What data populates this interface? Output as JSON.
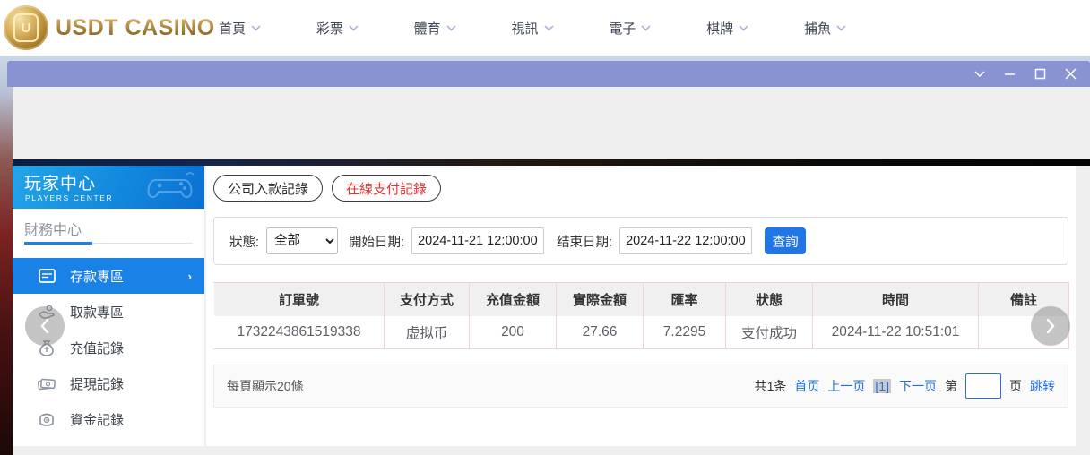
{
  "brand": {
    "name": "USDT CASINO",
    "emblem_letter": "U",
    "gold_color": "#a8823d"
  },
  "nav": {
    "items": [
      {
        "label": "首頁"
      },
      {
        "label": "彩票"
      },
      {
        "label": "體育"
      },
      {
        "label": "視訊"
      },
      {
        "label": "電子"
      },
      {
        "label": "棋牌"
      },
      {
        "label": "捕魚"
      }
    ]
  },
  "window": {
    "titlebar_color": "#8a93d2",
    "controls": [
      "collapse-icon",
      "minimize-icon",
      "maximize-icon",
      "close-icon"
    ]
  },
  "sidebar": {
    "title": "玩家中心",
    "subtitle": "PLAYERS CENTER",
    "section_title": "財務中心",
    "active_color": "#1a82e6",
    "items": [
      {
        "label": "存款專區",
        "icon": "deposit-card-icon",
        "active": true
      },
      {
        "label": "取款專區",
        "icon": "withdraw-hand-icon",
        "active": false
      },
      {
        "label": "充值記錄",
        "icon": "recharge-bag-icon",
        "active": false
      },
      {
        "label": "提現記錄",
        "icon": "cash-notes-icon",
        "active": false
      },
      {
        "label": "資金記錄",
        "icon": "funds-wallet-icon",
        "active": false
      }
    ]
  },
  "main": {
    "tabs": [
      {
        "label": "公司入款記錄",
        "active": false
      },
      {
        "label": "在線支付記錄",
        "active": true,
        "active_color": "#e53535"
      }
    ],
    "filters": {
      "status_label": "狀態:",
      "status_value": "全部",
      "start_label": "開始日期:",
      "start_value": "2024-11-21 12:00:00",
      "end_label": "结束日期:",
      "end_value": "2024-11-22 12:00:00",
      "query_button": "查詢",
      "query_color": "#2276e3"
    },
    "table": {
      "headers": [
        "訂單號",
        "支付方式",
        "充值金額",
        "實際金額",
        "匯率",
        "狀態",
        "時間",
        "備註"
      ],
      "rows": [
        [
          "1732243861519338",
          "虚拟币",
          "200",
          "27.66",
          "7.2295",
          "支付成功",
          "2024-11-22 10:51:01",
          ""
        ]
      ]
    },
    "footer": {
      "page_size_text": "每頁顯示20條",
      "total_text": "共1条",
      "first_label": "首页",
      "prev_label": "上一页",
      "current_page": "[1]",
      "next_label": "下一页",
      "jump_prefix": "第",
      "jump_suffix": "页",
      "jump_action": "跳转",
      "link_color": "#2270dd"
    }
  }
}
